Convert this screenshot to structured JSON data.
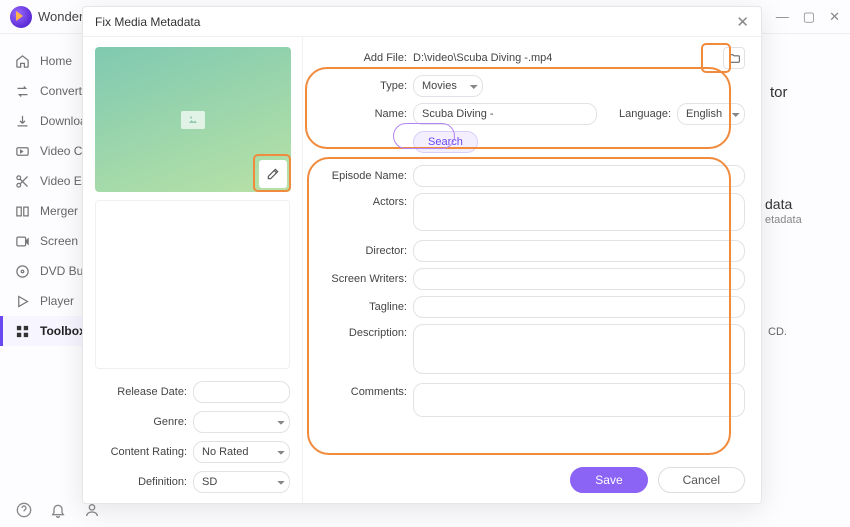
{
  "app": {
    "title": "Wondershare"
  },
  "window": {
    "min": "—",
    "max": "▢",
    "close": "✕"
  },
  "sidebar": {
    "items": [
      {
        "label": "Home",
        "icon": "home"
      },
      {
        "label": "Converter",
        "icon": "convert"
      },
      {
        "label": "Downloader",
        "icon": "download"
      },
      {
        "label": "Video Compressor",
        "icon": "compress"
      },
      {
        "label": "Video Editor",
        "icon": "scissors"
      },
      {
        "label": "Merger",
        "icon": "merge"
      },
      {
        "label": "Screen Recorder",
        "icon": "record"
      },
      {
        "label": "DVD Burner",
        "icon": "disc"
      },
      {
        "label": "Player",
        "icon": "play"
      },
      {
        "label": "Toolbox",
        "icon": "grid"
      }
    ],
    "active_index": 9
  },
  "bg": {
    "hint1": "tor",
    "hint2": "data",
    "hint3": "etadata",
    "hint4": "CD."
  },
  "modal": {
    "title": "Fix Media Metadata",
    "addfile_label": "Add File:",
    "addfile_value": "D:\\video\\Scuba Diving -.mp4",
    "type_label": "Type:",
    "type_value": "Movies",
    "name_label": "Name:",
    "name_value": "Scuba Diving -",
    "language_label": "Language:",
    "language_value": "English",
    "search_label": "Search",
    "fields": {
      "episode_label": "Episode Name:",
      "actors_label": "Actors:",
      "director_label": "Director:",
      "writers_label": "Screen Writers:",
      "tagline_label": "Tagline:",
      "description_label": "Description:",
      "comments_label": "Comments:"
    },
    "left": {
      "release_label": "Release Date:",
      "genre_label": "Genre:",
      "rating_label": "Content Rating:",
      "rating_value": "No Rated",
      "definition_label": "Definition:",
      "definition_value": "SD"
    },
    "buttons": {
      "save": "Save",
      "cancel": "Cancel"
    }
  },
  "bottom": {
    "help": "?",
    "bell": "bell",
    "user": "user"
  }
}
